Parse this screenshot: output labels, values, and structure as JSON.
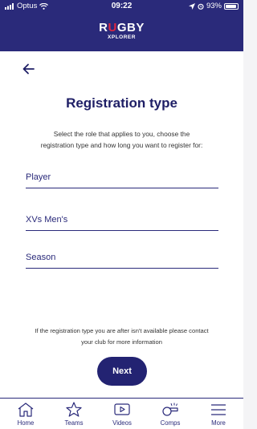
{
  "status_bar": {
    "carrier": "Optus",
    "time": "09:22",
    "battery": "93%",
    "battery_level": 0.93
  },
  "header": {
    "logo_part1": "RU",
    "logo_part2": "GBY",
    "logo_sub": "XPLORER",
    "accent_color": "#e0263f",
    "brand_color": "#2a2a7a"
  },
  "page": {
    "back_icon": "arrow-left-icon",
    "title": "Registration type",
    "intro": "Select the role that applies to you, choose the registration type and how long you want to register for:",
    "fields": {
      "role": "Player",
      "registration_type": "XVs Men's",
      "duration": "Season"
    },
    "notice": "If the registration type you are after isn't available please contact your club for more information",
    "next_label": "Next"
  },
  "tabbar": {
    "items": [
      {
        "label": "Home",
        "icon": "house-icon"
      },
      {
        "label": "Teams",
        "icon": "star-icon"
      },
      {
        "label": "Videos",
        "icon": "play-icon"
      },
      {
        "label": "Comps",
        "icon": "whistle-icon"
      },
      {
        "label": "More",
        "icon": "menu-icon"
      }
    ]
  }
}
